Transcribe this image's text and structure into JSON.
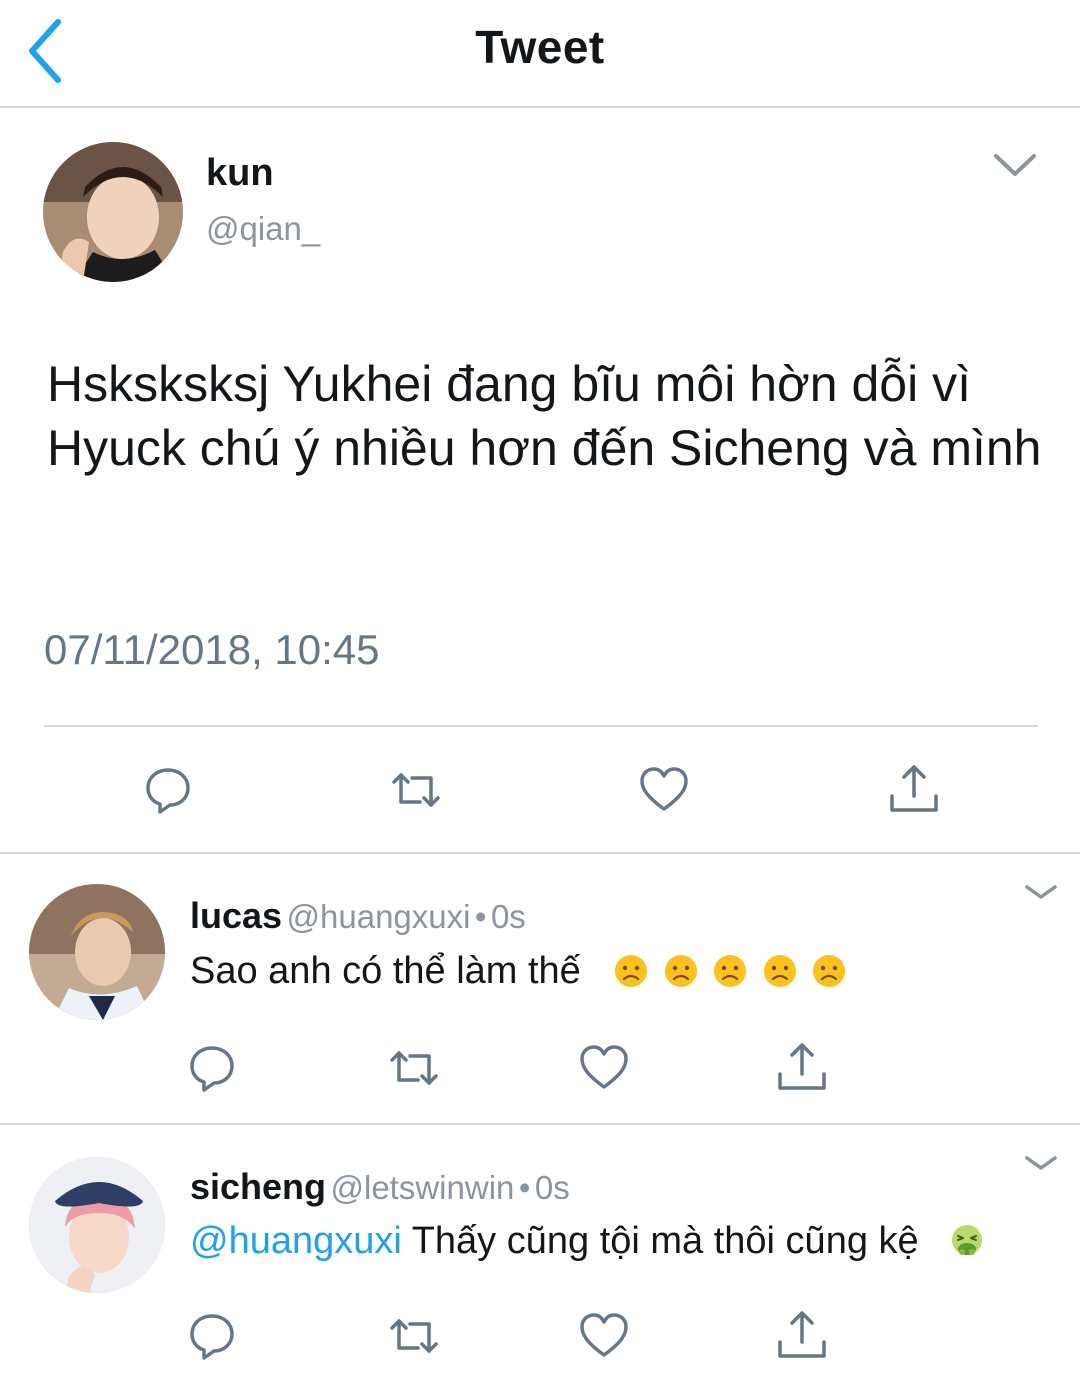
{
  "header": {
    "title": "Tweet"
  },
  "main_tweet": {
    "display_name": "kun",
    "handle": "@qian_",
    "text": "Hsksksksj Yukhei đang bĩu môi hờn dỗi vì Hyuck chú ý nhiều hơn đến Sicheng và mình",
    "timestamp": "07/11/2018, 10:45"
  },
  "replies": [
    {
      "display_name": "lucas",
      "handle": "@huangxuxi",
      "separator": "•",
      "time": "0s",
      "text": "Sao anh có thể làm thế",
      "emoji": [
        "frowning-face",
        "frowning-face",
        "frowning-face",
        "frowning-face",
        "frowning-face"
      ]
    },
    {
      "display_name": "sicheng",
      "handle": "@letswinwin",
      "separator": "•",
      "time": "0s",
      "mention": "@huangxuxi",
      "text": "Thấy cũng tội mà thôi cũng kệ",
      "emoji": [
        "nauseated-face"
      ]
    }
  ],
  "icons": {
    "back": "chevron-left-icon",
    "more": "chevron-down-icon",
    "reply": "reply-icon",
    "retweet": "retweet-icon",
    "like": "heart-icon",
    "share": "share-icon"
  },
  "colors": {
    "accent": "#1da1f2",
    "text": "#14171a",
    "secondary": "#657786",
    "divider": "#d5d9dc"
  }
}
